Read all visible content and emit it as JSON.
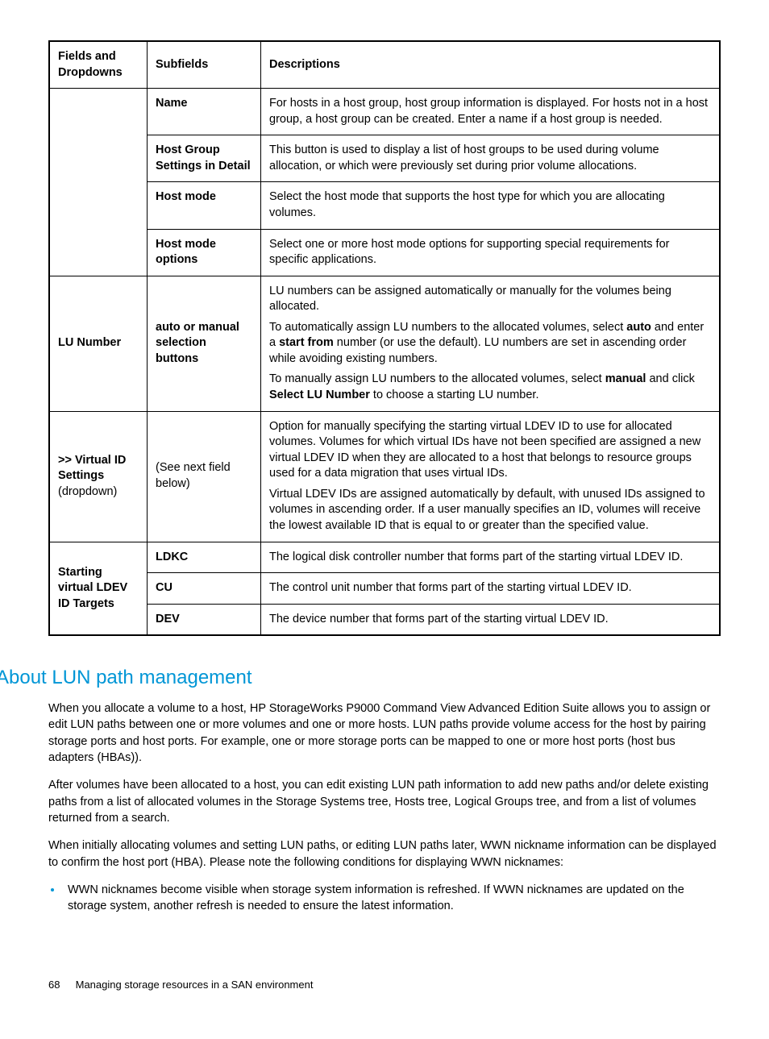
{
  "table": {
    "headers": {
      "col1": "Fields and Dropdowns",
      "col2": "Subfields",
      "col3": "Descriptions"
    },
    "name": {
      "subfield": "Name",
      "desc": "For hosts in a host group, host group information is displayed. For hosts not in a host group, a host group can be created. Enter a name if a host group is needed."
    },
    "hgsd": {
      "subfield": "Host Group Settings in Detail",
      "desc": "This button is used to display a list of host groups to be used during volume allocation, or which were previously set during prior volume allocations."
    },
    "hostmode": {
      "subfield": "Host mode",
      "desc": "Select the host mode that supports the host type for which you are allocating volumes."
    },
    "hmopt": {
      "subfield": "Host mode options",
      "desc": "Select one or more host mode options for supporting special requirements for specific applications."
    },
    "lunumber": {
      "field": "LU Number",
      "subfield": "auto or manual selection buttons",
      "p1": "LU numbers can be assigned automatically or manually for the volumes being allocated.",
      "p2a": "To automatically assign LU numbers to the allocated volumes, select ",
      "p2b": "auto",
      "p2c": " and enter a ",
      "p2d": "start from",
      "p2e": " number (or use the default). LU numbers are set in ascending order while avoiding existing numbers.",
      "p3a": "To manually assign LU numbers to the allocated volumes, select ",
      "p3b": "manual",
      "p3c": " and click ",
      "p3d": "Select LU Number",
      "p3e": " to choose a starting LU number."
    },
    "virtualid": {
      "field_a": ">> Virtual ID Settings",
      "field_b": " (dropdown)",
      "subfield": "(See next field below)",
      "p1": "Option for manually specifying the starting virtual LDEV ID to use for allocated volumes. Volumes for which virtual IDs have not been specified are assigned a new virtual LDEV ID when they are allocated to a host that belongs to resource groups used for a data migration that uses virtual IDs.",
      "p2": "Virtual LDEV IDs are assigned automatically by default, with unused IDs assigned to volumes in ascending order. If a user manually specifies an ID, volumes will receive the lowest available ID that is equal to or greater than the specified value."
    },
    "starting": {
      "field": "Starting virtual LDEV ID Targets",
      "ldkc": {
        "sub": "LDKC",
        "desc": "The logical disk controller number that forms part of the starting virtual LDEV ID."
      },
      "cu": {
        "sub": "CU",
        "desc": "The control unit number that forms part of the starting virtual LDEV ID."
      },
      "dev": {
        "sub": "DEV",
        "desc": "The device number that forms part of the starting virtual LDEV ID."
      }
    }
  },
  "section": {
    "heading": "About LUN path management",
    "p1": "When you allocate a volume to a host, HP StorageWorks P9000 Command View Advanced Edition Suite allows you to assign or edit LUN paths between one or more volumes and one or more hosts. LUN paths provide volume access for the host by pairing storage ports and host ports. For example, one or more storage ports can be mapped to one or more host ports (host bus adapters (HBAs)).",
    "p2": "After volumes have been allocated to a host, you can edit existing LUN path information to add new paths and/or delete existing paths from a list of allocated volumes in the Storage Systems tree, Hosts tree, Logical Groups tree, and from a list of volumes returned from a search.",
    "p3": "When initially allocating volumes and setting LUN paths, or editing LUN paths later, WWN nickname information can be displayed to confirm the host port (HBA). Please note the following conditions for displaying WWN nicknames:",
    "bullet1": "WWN nicknames become visible when storage system information is refreshed. If WWN nicknames are updated on the storage system, another refresh is needed to ensure the latest information."
  },
  "footer": {
    "page": "68",
    "title": "Managing storage resources in a SAN environment"
  }
}
